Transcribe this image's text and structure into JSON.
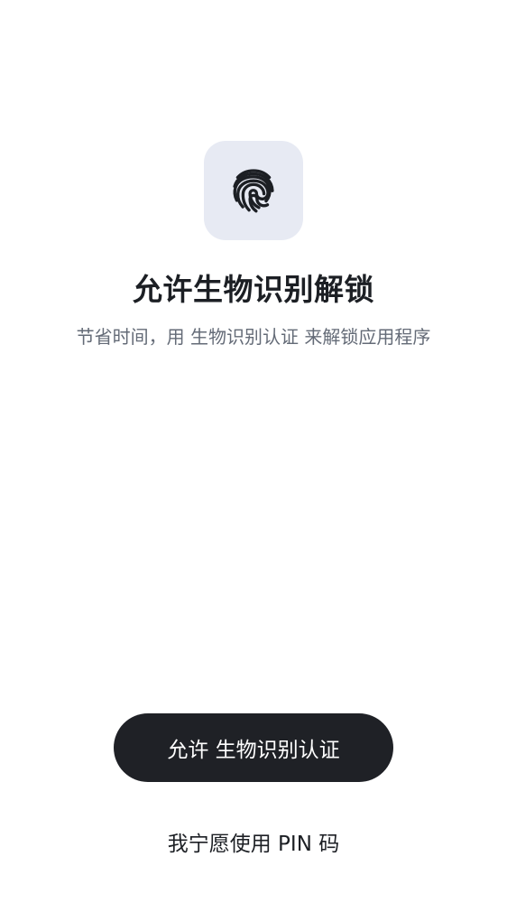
{
  "icon": {
    "name": "fingerprint-icon"
  },
  "title": "允许生物识别解锁",
  "subtitle": "节省时间，用 生物识别认证 来解锁应用程序",
  "primary_button": {
    "label": "允许 生物识别认证"
  },
  "secondary_link": {
    "label": "我宁愿使用 PIN 码"
  },
  "colors": {
    "icon_tile_bg": "#e7eaf3",
    "button_bg": "#1f2126",
    "subtitle_text": "#646b77"
  }
}
